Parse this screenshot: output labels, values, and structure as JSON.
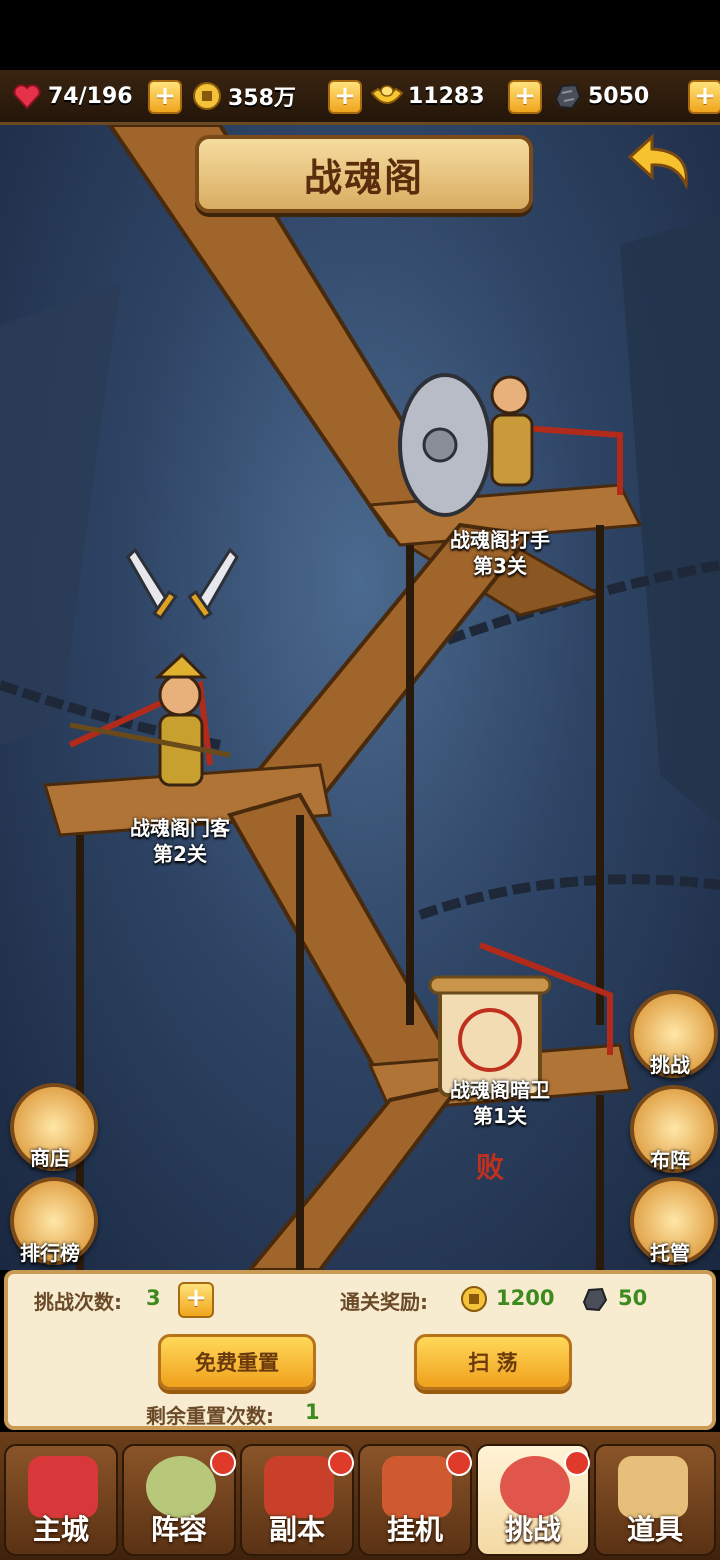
{
  "resources": [
    {
      "icon": "heart-stamina-icon",
      "value": "74/196"
    },
    {
      "icon": "coin-icon",
      "value": "358万"
    },
    {
      "icon": "gold-ingot-icon",
      "value": "11283"
    },
    {
      "icon": "ore-stone-icon",
      "value": "5050"
    }
  ],
  "page_title": "战魂阁",
  "stages": [
    {
      "name": "战魂阁打手",
      "level": "第3关"
    },
    {
      "name": "战魂阁门客",
      "level": "第2关"
    },
    {
      "name": "战魂阁暗卫",
      "level": "第1关"
    }
  ],
  "defeated_stamp": "败",
  "side_left": [
    "商店",
    "排行榜"
  ],
  "side_right": [
    "挑战",
    "布阵",
    "托管"
  ],
  "panel": {
    "challenge_label": "挑战次数:",
    "challenge_count": "3",
    "reward_label": "通关奖励:",
    "reward_coin": "1200",
    "reward_ore": "50",
    "reset_button": "免费重置",
    "sweep_button": "扫 荡",
    "remaining_label": "剩余重置次数:",
    "remaining_count": "1"
  },
  "nav": [
    "主城",
    "阵容",
    "副本",
    "挂机",
    "挑战",
    "道具"
  ],
  "active_tab": "挑战",
  "colors": {
    "accent_gold": "#f0a11c",
    "title_text": "#5a2e0c",
    "value_green": "#3d8a1e",
    "badge_red": "#e03a2a"
  }
}
